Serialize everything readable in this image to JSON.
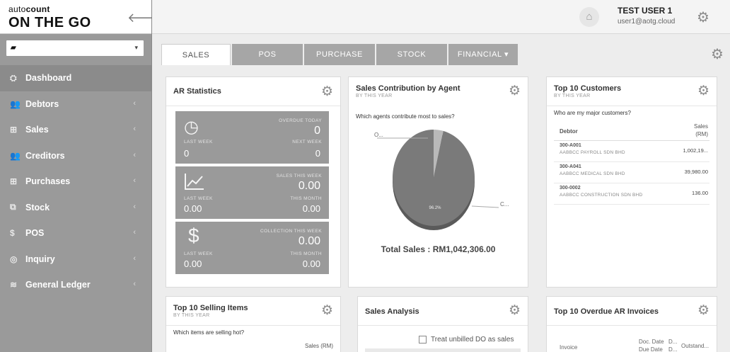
{
  "brand": {
    "logo_auto": "auto",
    "logo_count": "count",
    "logo_main": "ON THE GO"
  },
  "company_select": {
    "value": ""
  },
  "nav": [
    {
      "label": "Dashboard",
      "icon": "dashboard-icon",
      "glyph": "⛭",
      "active": true
    },
    {
      "label": "Debtors",
      "icon": "users-icon",
      "glyph": "👥",
      "chevron": "‹"
    },
    {
      "label": "Sales",
      "icon": "cart-icon",
      "glyph": "⊞",
      "chevron": "‹"
    },
    {
      "label": "Creditors",
      "icon": "users-icon",
      "glyph": "👥",
      "chevron": "‹"
    },
    {
      "label": "Purchases",
      "icon": "cart-icon",
      "glyph": "⊞",
      "chevron": "‹"
    },
    {
      "label": "Stock",
      "icon": "cubes-icon",
      "glyph": "⧉",
      "chevron": "‹"
    },
    {
      "label": "POS",
      "icon": "dollar-icon",
      "glyph": "$",
      "chevron": "‹"
    },
    {
      "label": "Inquiry",
      "icon": "binoculars-icon",
      "glyph": "◎",
      "chevron": "‹"
    },
    {
      "label": "General Ledger",
      "icon": "coins-icon",
      "glyph": "≋",
      "chevron": "‹"
    }
  ],
  "user": {
    "name": "TEST USER 1",
    "email": "user1@aotg.cloud"
  },
  "tabs": [
    "SALES",
    "POS",
    "PURCHASE",
    "STOCK",
    "FINANCIAL ▾"
  ],
  "ar_statistics": {
    "title": "AR Statistics",
    "tile1": {
      "top_label": "OVERDUE TODAY",
      "top_value": "0",
      "left_label": "LAST WEEK",
      "left_value": "0",
      "right_label": "NEXT WEEK",
      "right_value": "0"
    },
    "tile2": {
      "top_label": "SALES THIS WEEK",
      "top_value": "0.00",
      "left_label": "LAST WEEK",
      "left_value": "0.00",
      "right_label": "THIS MONTH",
      "right_value": "0.00"
    },
    "tile3": {
      "top_label": "COLLECTION THIS WEEK",
      "top_value": "0.00",
      "left_label": "LAST WEEK",
      "left_value": "0.00",
      "right_label": "THIS MONTH",
      "right_value": "0.00"
    }
  },
  "sales_by_agent": {
    "title": "Sales Contribution by Agent",
    "subtitle": "BY THIS YEAR",
    "question": "Which agents contribute most to sales?",
    "total": "Total Sales : RM1,042,306.00",
    "label_o": "O...",
    "label_c": "C...",
    "slice_label": "96.2%"
  },
  "top_customers": {
    "title": "Top 10 Customers",
    "subtitle": "BY THIS YEAR",
    "question": "Who are my major customers?",
    "col_debtor": "Debtor",
    "col_sales": "Sales",
    "col_sales_unit": "(RM)",
    "rows": [
      {
        "code": "300-A001",
        "name": "AABBCC PAYROLL SDN BHD",
        "amount": "1,002,19..."
      },
      {
        "code": "300-A041",
        "name": "AABBCC MEDICAL SDN BHD",
        "amount": "39,980.00"
      },
      {
        "code": "300-0002",
        "name": "AABBCC CONSTRUCTION SDN BHD",
        "amount": "136.00"
      }
    ]
  },
  "top_items": {
    "title": "Top 10 Selling Items",
    "subtitle": "BY THIS YEAR",
    "question": "Which items are selling hot?",
    "col_sales": "Sales (RM)"
  },
  "sales_analysis": {
    "title": "Sales Analysis",
    "checkbox_label": "Treat unbilled DO as sales"
  },
  "overdue_ar": {
    "title": "Top 10 Overdue AR Invoices",
    "col_invoice": "Invoice",
    "col_doc_date": "Doc. Date",
    "col_due_date": "Due Date",
    "col_d": "D...",
    "col_outstanding": "Outstand..."
  },
  "chart_data": {
    "type": "pie",
    "title": "Sales Contribution by Agent",
    "labels": [
      "O...",
      "C..."
    ],
    "values": [
      3.8,
      96.2
    ]
  }
}
